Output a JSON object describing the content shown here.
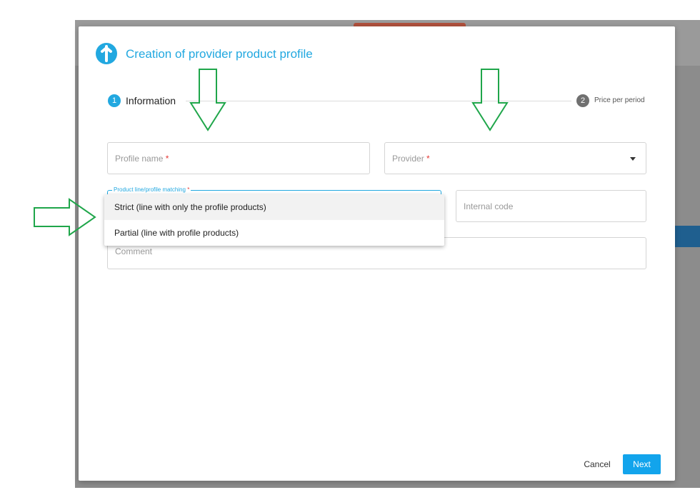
{
  "dialog": {
    "title": "Creation of provider product profile"
  },
  "stepper": {
    "steps": [
      {
        "number": "1",
        "label": "Information"
      },
      {
        "number": "2",
        "label": "Price per period"
      }
    ]
  },
  "form": {
    "profile_name": {
      "placeholder": "Profile name",
      "required_mark": "*"
    },
    "provider": {
      "placeholder": "Provider",
      "required_mark": "*"
    },
    "matching": {
      "label": "Product line/profile matching",
      "required_mark": "*"
    },
    "internal_code": {
      "placeholder": "Internal code"
    },
    "comment": {
      "placeholder": "Comment"
    }
  },
  "dropdown": {
    "options": [
      "Strict (line with only the profile products)",
      "Partial (line with profile products)"
    ]
  },
  "footer": {
    "cancel_label": "Cancel",
    "next_label": "Next"
  },
  "colors": {
    "accent": "#22a8e0",
    "annotation_arrow": "#1fa64a",
    "next_button": "#12a4ec"
  }
}
